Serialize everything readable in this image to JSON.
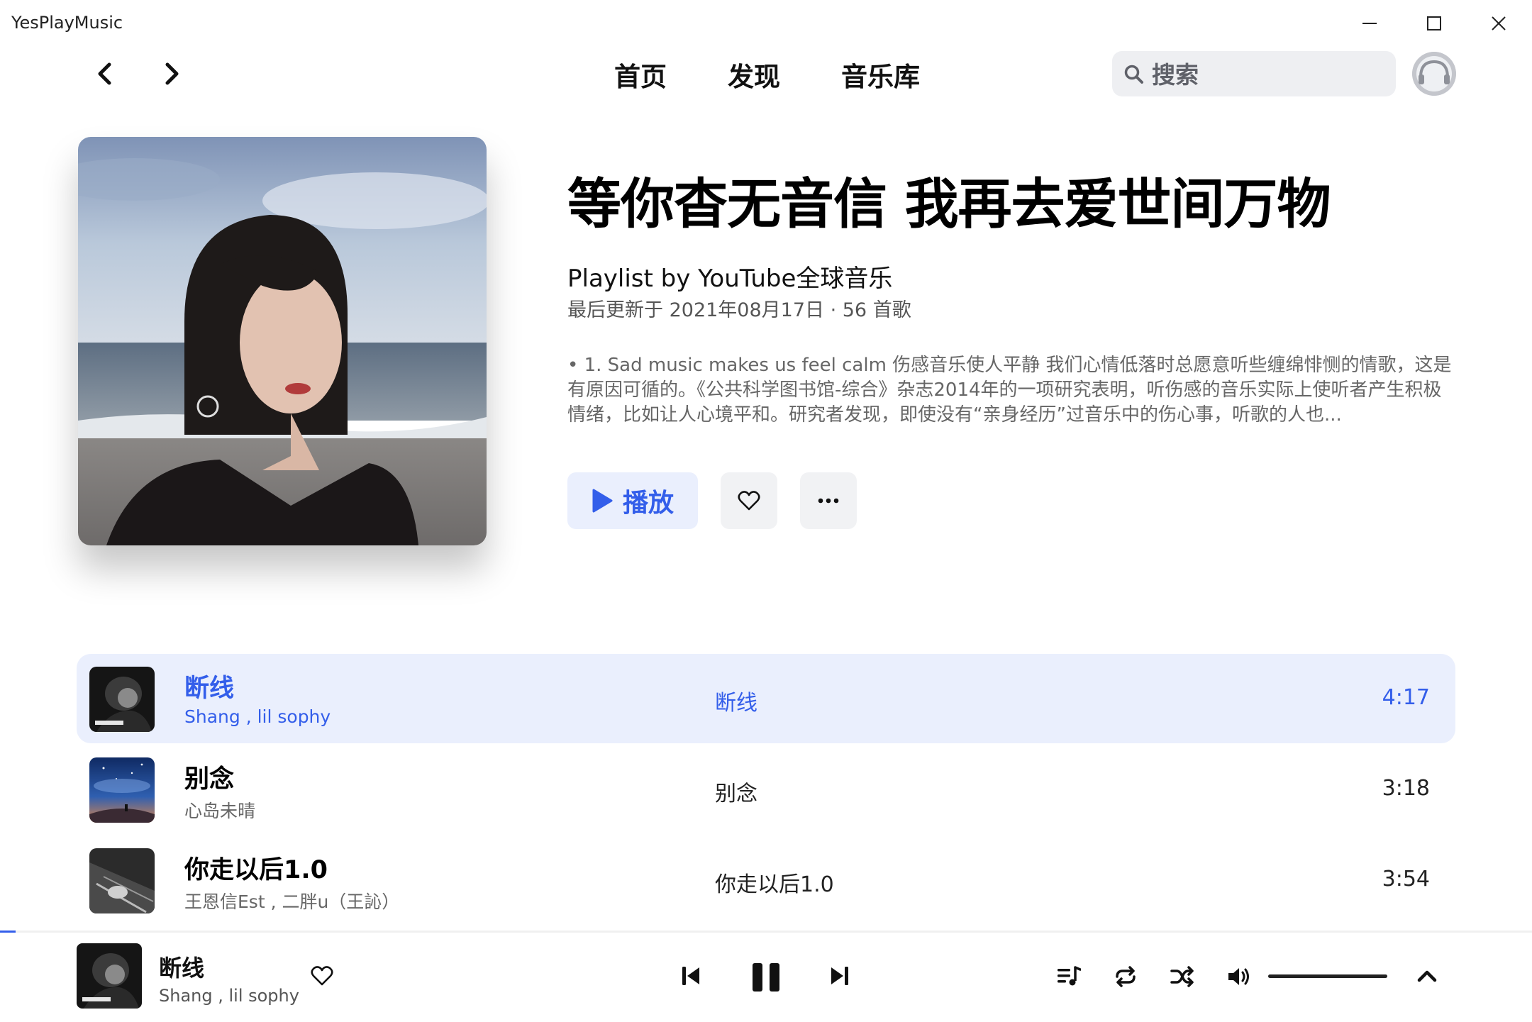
{
  "window": {
    "title": "YesPlayMusic"
  },
  "nav": {
    "links": [
      "首页",
      "发现",
      "音乐库"
    ],
    "search_placeholder": "搜索"
  },
  "playlist": {
    "title": "等你杳无音信 我再去爱世间万物",
    "owner": "Playlist by YouTube全球音乐",
    "meta": "最后更新于 2021年08月17日 · 56 首歌",
    "description": "• 1. Sad music makes us feel calm 伤感音乐使人平静 我们心情低落时总愿意听些缠绵悱恻的情歌，这是有原因可循的。《公共科学图书馆-综合》杂志2014年的一项研究表明，听伤感的音乐实际上使听者产生积极情绪，比如让人心境平和。研究者发现，即使没有“亲身经历”过音乐中的伤心事，听歌的人也...",
    "play_label": "播放"
  },
  "tracks": [
    {
      "name": "断线",
      "artist": "Shang , lil sophy",
      "album": "断线",
      "duration": "4:17",
      "active": true
    },
    {
      "name": "别念",
      "artist": "心岛未晴",
      "album": "别念",
      "duration": "3:18",
      "active": false
    },
    {
      "name": "你走以后1.0",
      "artist": "王恩信Est , 二胖u（王訫）",
      "album": "你走以后1.0",
      "duration": "3:54",
      "active": false
    }
  ],
  "player": {
    "track_name": "断线",
    "track_artist": "Shang , lil sophy",
    "progress": 0.01,
    "volume": 1.0
  },
  "colors": {
    "accent": "#335eea",
    "accent_bg": "#eaeffd"
  },
  "icons": {
    "back": "chevron-left-icon",
    "forward": "chevron-right-icon",
    "search": "search-icon",
    "heart": "heart-icon",
    "more": "more-icon",
    "prev": "skip-previous-icon",
    "pause": "pause-icon",
    "next": "skip-next-icon",
    "queue": "queue-icon",
    "repeat": "repeat-icon",
    "shuffle": "shuffle-icon",
    "volume": "volume-icon",
    "expand": "chevron-up-icon"
  }
}
